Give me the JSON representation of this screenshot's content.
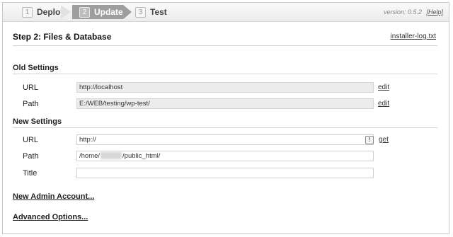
{
  "steps": [
    {
      "num": "1",
      "label": "Deploy"
    },
    {
      "num": "2",
      "label": "Update"
    },
    {
      "num": "3",
      "label": "Test"
    }
  ],
  "version": {
    "text": "version: 0.5.2",
    "help": "[Help]"
  },
  "page": {
    "title": "Step 2: Files & Database",
    "log_link": "installer-log.txt"
  },
  "old_settings": {
    "title": "Old Settings",
    "url": {
      "label": "URL",
      "value": "http://localhost",
      "action": "edit"
    },
    "path": {
      "label": "Path",
      "value": "E:/WEB/testing/wp-test/",
      "action": "edit"
    }
  },
  "new_settings": {
    "title": "New Settings",
    "url": {
      "label": "URL",
      "value": "http://",
      "action": "get",
      "warn": "!"
    },
    "path": {
      "label": "Path",
      "value_prefix": "/home/",
      "value_suffix": "/public_html/"
    },
    "title_field": {
      "label": "Title",
      "value": ""
    }
  },
  "links": {
    "admin": "New Admin Account...",
    "advanced": "Advanced Options..."
  }
}
